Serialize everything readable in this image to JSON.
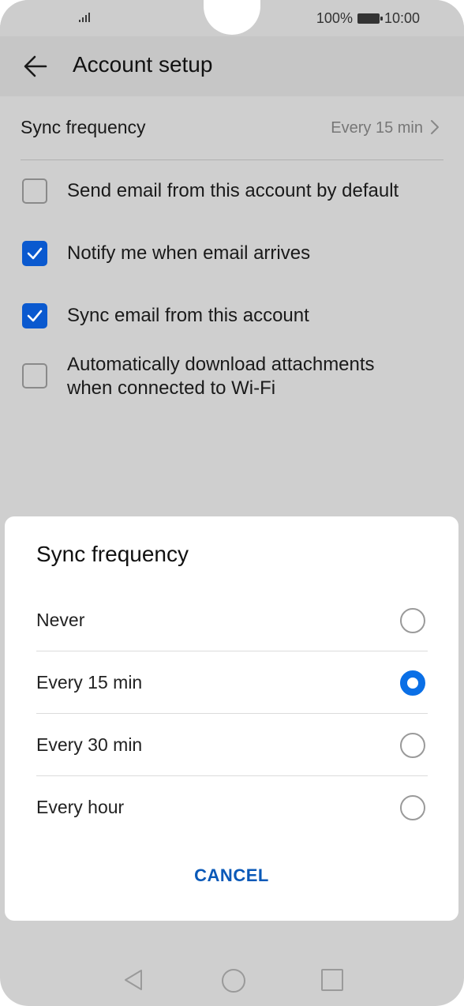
{
  "status_bar": {
    "battery_percent": "100%",
    "time": "10:00",
    "icons": [
      "signal-icon",
      "battery-icon"
    ]
  },
  "header": {
    "title": "Account setup",
    "back_icon": "arrow-left-icon"
  },
  "settings": {
    "sync_frequency": {
      "label": "Sync frequency",
      "value": "Every 15 min"
    },
    "checkboxes": [
      {
        "label": "Send email from this account by default",
        "checked": false
      },
      {
        "label": "Notify me when email arrives",
        "checked": true
      },
      {
        "label": "Sync email from this account",
        "checked": true
      },
      {
        "label": "Automatically download attachments when connected to Wi-Fi",
        "checked": false
      }
    ]
  },
  "dialog": {
    "title": "Sync frequency",
    "options": [
      {
        "label": "Never",
        "selected": false
      },
      {
        "label": "Every 15 min",
        "selected": true
      },
      {
        "label": "Every 30 min",
        "selected": false
      },
      {
        "label": "Every hour",
        "selected": false
      }
    ],
    "cancel_label": "CANCEL"
  },
  "colors": {
    "accent": "#0A59CF",
    "radio_selected": "#0A6FE6",
    "overlay": "#CFCFCF"
  },
  "nav_bar": [
    "back-triangle-icon",
    "home-circle-icon",
    "recents-square-icon"
  ]
}
